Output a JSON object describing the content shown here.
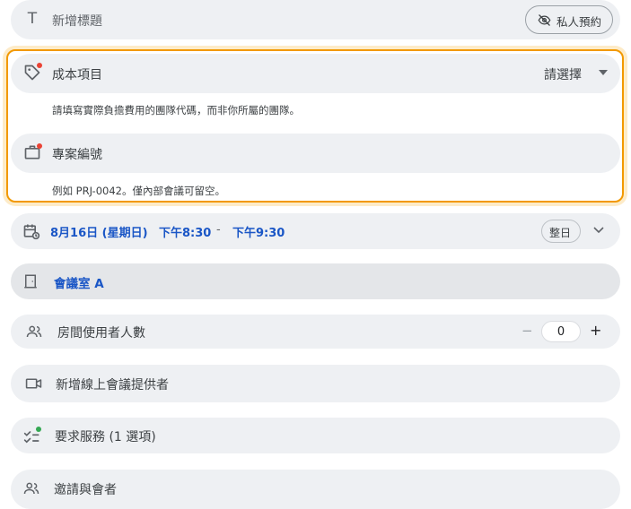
{
  "title_row": {
    "placeholder": "新增標題",
    "private_label": "私人預約"
  },
  "cost_center": {
    "label": "成本項目",
    "select_value": "請選擇",
    "helper": "請填寫實際負擔費用的團隊代碼，而非你所屬的團隊。"
  },
  "project": {
    "label": "專案編號",
    "helper": "例如 PRJ-0042。僅內部會議可留空。"
  },
  "datetime": {
    "date": "8月16日 (星期日)",
    "start": "下午8:30",
    "sep": "-",
    "end": "下午9:30",
    "allday": "整日"
  },
  "room": {
    "label": "會議室 A"
  },
  "capacity": {
    "label": "房間使用者人數",
    "minus": "−",
    "value": "0",
    "plus": "+"
  },
  "conference": {
    "label": "新增線上會議提供者"
  },
  "services": {
    "label": "要求服務 (1 選項)"
  },
  "guests": {
    "label": "邀請與會者"
  },
  "colors": {
    "accent": "#1a56c6",
    "highlight_border": "#f29900",
    "required_dot": "#ea4335",
    "ok_dot": "#34a853"
  }
}
